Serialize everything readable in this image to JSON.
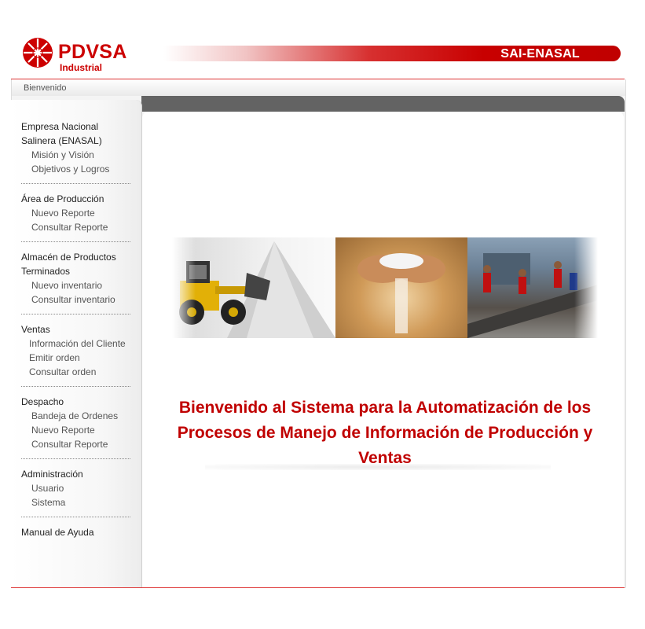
{
  "header": {
    "brand": "PDVSA",
    "brand_sub": "Industrial",
    "app_title": "SAI-ENASAL"
  },
  "breadcrumb": "Bienvenido",
  "sidebar": {
    "sections": [
      {
        "title": "Empresa Nacional Salinera (ENASAL)",
        "items": [
          "Misión y Visión",
          "Objetivos y Logros"
        ]
      },
      {
        "title": "Área de Producción",
        "items": [
          "Nuevo Reporte",
          "Consultar Reporte"
        ]
      },
      {
        "title": "Almacén de Productos Terminados",
        "items": [
          "Nuevo inventario",
          "Consultar inventario"
        ]
      },
      {
        "title": "Ventas",
        "items": [
          "Información del Cliente",
          "Emitir orden",
          "Consultar orden"
        ]
      },
      {
        "title": "Despacho",
        "items": [
          "Bandeja de Ordenes",
          "Nuevo Reporte",
          "Consultar Reporte"
        ]
      },
      {
        "title": "Administración",
        "items": [
          "Usuario",
          "Sistema"
        ]
      },
      {
        "title": "Manual de Ayuda",
        "items": []
      }
    ]
  },
  "main": {
    "welcome": "Bienvenido al Sistema para la Automatización de los Procesos de Manejo de Información de Producción y Ventas"
  },
  "colors": {
    "brand_red": "#cc0000",
    "dark_bar": "#636363"
  }
}
